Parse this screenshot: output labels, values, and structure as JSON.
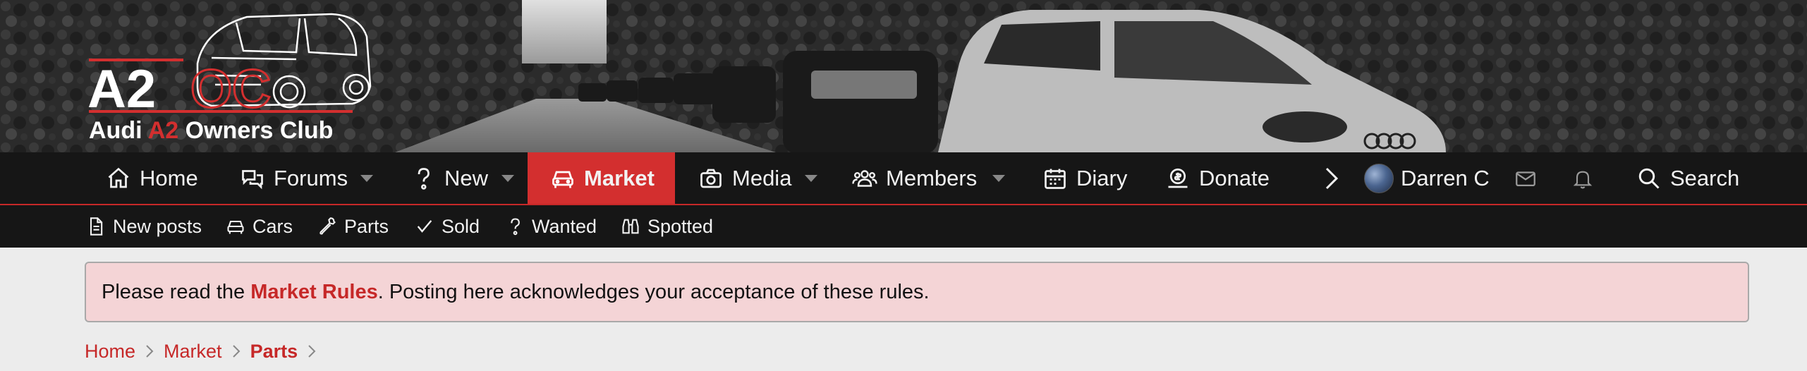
{
  "logo": {
    "mark_left": "A2",
    "mark_right": "OC",
    "tagline_part1": "Audi",
    "tagline_accent": "A2",
    "tagline_part2": "Owners Club"
  },
  "colors": {
    "accent": "#d32f2f",
    "nav_bg": "#161616",
    "page_bg": "#ececec",
    "notice_bg": "#f4d4d6"
  },
  "main_nav": {
    "items": [
      {
        "label": "Home",
        "icon": "home-icon",
        "has_dropdown": false,
        "active": false
      },
      {
        "label": "Forums",
        "icon": "comments-icon",
        "has_dropdown": true,
        "active": false
      },
      {
        "label": "New",
        "icon": "question-icon",
        "has_dropdown": true,
        "active": false
      },
      {
        "label": "Market",
        "icon": "car-icon",
        "has_dropdown": false,
        "active": true
      },
      {
        "label": "Media",
        "icon": "camera-icon",
        "has_dropdown": true,
        "active": false
      },
      {
        "label": "Members",
        "icon": "users-icon",
        "has_dropdown": true,
        "active": false
      },
      {
        "label": "Diary",
        "icon": "calendar-icon",
        "has_dropdown": false,
        "active": false
      },
      {
        "label": "Donate",
        "icon": "donate-icon",
        "has_dropdown": false,
        "active": false
      }
    ],
    "more_icon": "chevron-right-icon",
    "user_name": "Darren C",
    "inbox_icon": "envelope-icon",
    "alerts_icon": "bell-icon",
    "search_label": "Search",
    "search_icon": "search-icon"
  },
  "sub_nav": {
    "items": [
      {
        "label": "New posts",
        "icon": "file-icon"
      },
      {
        "label": "Cars",
        "icon": "car-icon"
      },
      {
        "label": "Parts",
        "icon": "wrench-icon"
      },
      {
        "label": "Sold",
        "icon": "check-icon"
      },
      {
        "label": "Wanted",
        "icon": "question-icon"
      },
      {
        "label": "Spotted",
        "icon": "binoculars-icon"
      }
    ]
  },
  "notice": {
    "prefix": "Please read the ",
    "link": "Market Rules",
    "suffix": ". Posting here acknowledges your acceptance of these rules."
  },
  "breadcrumb": {
    "items": [
      "Home",
      "Market",
      "Parts"
    ]
  }
}
